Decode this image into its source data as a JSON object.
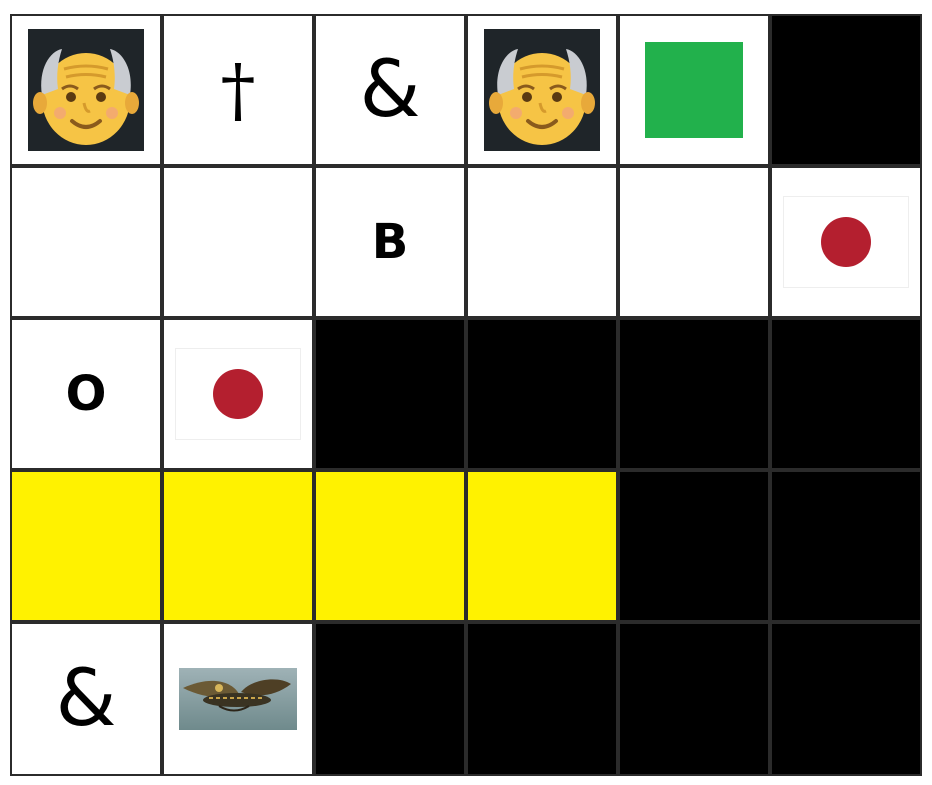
{
  "board": {
    "cols": 6,
    "rows": 5,
    "cells": [
      [
        {
          "type": "old-man"
        },
        {
          "type": "text",
          "kind": "cross",
          "text": "†"
        },
        {
          "type": "text",
          "kind": "amp",
          "text": "&"
        },
        {
          "type": "old-man"
        },
        {
          "type": "green-square"
        },
        {
          "type": "black"
        }
      ],
      [
        {
          "type": "empty"
        },
        {
          "type": "empty"
        },
        {
          "type": "text",
          "kind": "letter",
          "text": "B"
        },
        {
          "type": "empty"
        },
        {
          "type": "empty"
        },
        {
          "type": "japan-flag"
        }
      ],
      [
        {
          "type": "text",
          "kind": "letter",
          "text": "O"
        },
        {
          "type": "japan-flag"
        },
        {
          "type": "black"
        },
        {
          "type": "black"
        },
        {
          "type": "black"
        },
        {
          "type": "black"
        }
      ],
      [
        {
          "type": "yellow"
        },
        {
          "type": "yellow"
        },
        {
          "type": "yellow"
        },
        {
          "type": "yellow"
        },
        {
          "type": "black"
        },
        {
          "type": "black"
        }
      ],
      [
        {
          "type": "text",
          "kind": "amp",
          "text": "&"
        },
        {
          "type": "moth"
        },
        {
          "type": "black"
        },
        {
          "type": "black"
        },
        {
          "type": "black"
        },
        {
          "type": "black"
        }
      ]
    ]
  },
  "icons": {
    "old-man": "old-man-face-icon",
    "green-square": "green-square-icon",
    "japan-flag": "japan-flag-icon",
    "moth": "moth-image"
  },
  "colors": {
    "yellow": "#fff200",
    "green": "#22b14c",
    "flag_red": "#b41f2f",
    "black": "#000000",
    "grid": "#2b2b2b"
  }
}
